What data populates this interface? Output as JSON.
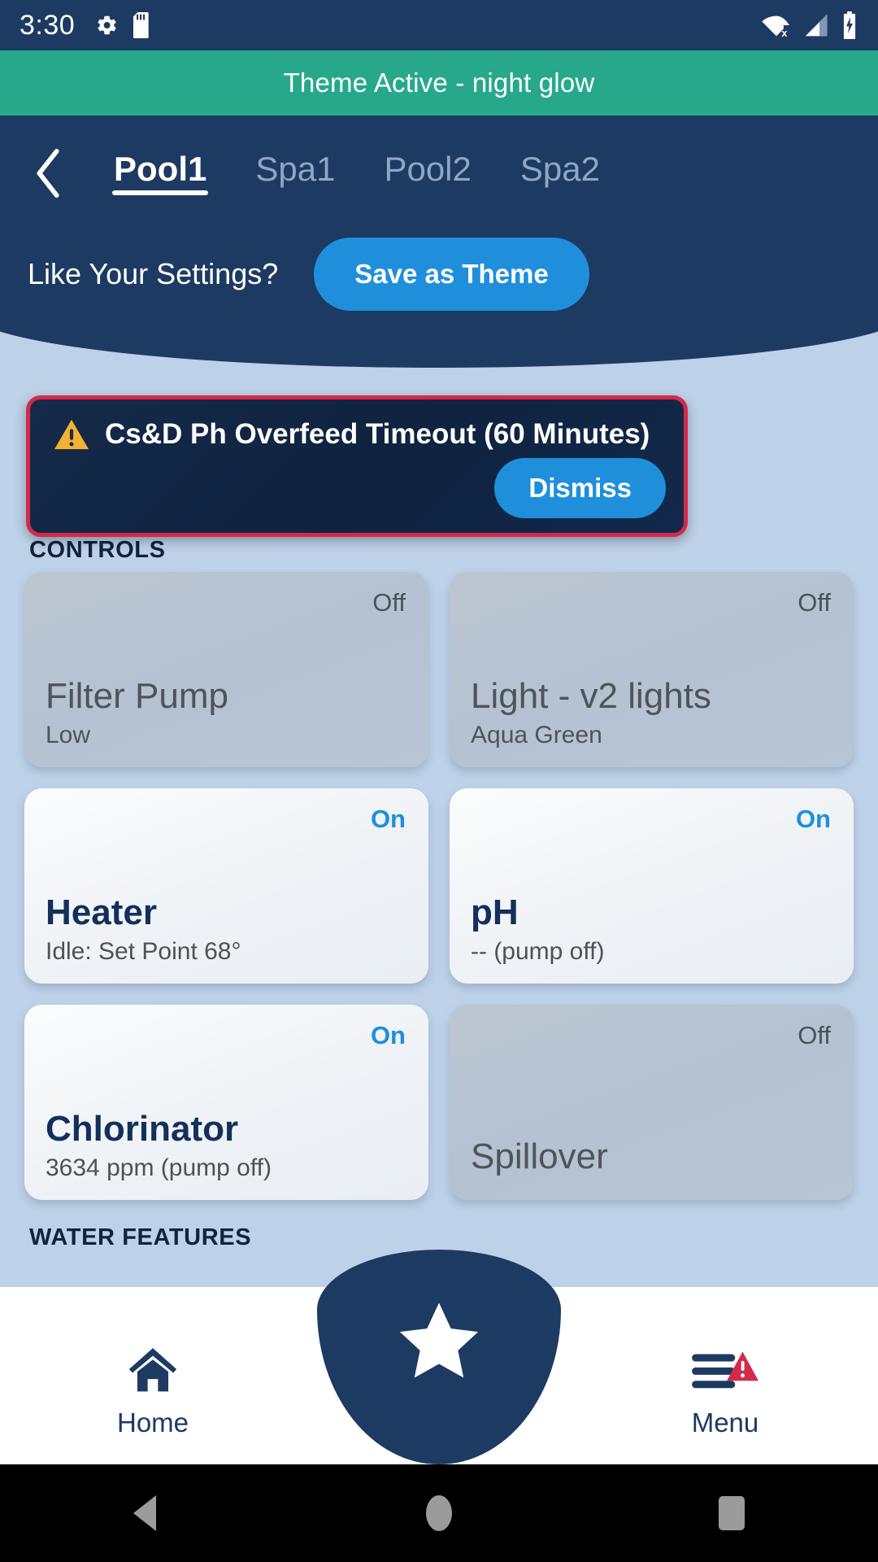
{
  "status_bar": {
    "time": "3:30",
    "left_icons": [
      "gear-icon",
      "sd-card-icon"
    ],
    "right_icons": [
      "wifi-off-icon",
      "cellular-signal-icon",
      "battery-charging-icon"
    ],
    "background": "#1d3a62"
  },
  "theme_banner": {
    "text": "Theme Active - night glow",
    "background": "#27a88b"
  },
  "header": {
    "back_icon": "chevron-left-icon",
    "tabs": [
      {
        "label": "Pool1",
        "active": true
      },
      {
        "label": "Spa1",
        "active": false
      },
      {
        "label": "Pool2",
        "active": false
      },
      {
        "label": "Spa2",
        "active": false
      }
    ],
    "settings_question": "Like Your Settings?",
    "save_theme_label": "Save as Theme",
    "accent": "#1f8fdb",
    "background": "#1d3a62"
  },
  "alert": {
    "icon": "warning-triangle-icon",
    "message": "Cs&D Ph Overfeed Timeout (60 Minutes)",
    "dismiss_label": "Dismiss",
    "border_color": "#d42a4a",
    "icon_color": "#f2b233"
  },
  "sections": {
    "controls_label": "CONTROLS",
    "water_features_label": "WATER FEATURES"
  },
  "controls": [
    {
      "name": "Filter Pump",
      "state": "Off",
      "sub": "Low",
      "on": false
    },
    {
      "name": "Light - v2 lights",
      "state": "Off",
      "sub": "Aqua Green",
      "on": false
    },
    {
      "name": "Heater",
      "state": "On",
      "sub": "Idle: Set Point 68°",
      "on": true
    },
    {
      "name": "pH",
      "state": "On",
      "sub": "-- (pump off)",
      "on": true
    },
    {
      "name": "Chlorinator",
      "state": "On",
      "sub": "3634 ppm (pump off)",
      "on": true
    },
    {
      "name": "Spillover",
      "state": "Off",
      "sub": "",
      "on": false
    }
  ],
  "bottom_nav": {
    "items": [
      {
        "label": "Home",
        "icon": "home-icon"
      },
      {
        "label": "Menu",
        "icon": "hamburger-menu-alert-icon"
      }
    ],
    "center_icon": "star-icon",
    "background": "#ffffff",
    "notch_color": "#1d3a62",
    "alert_badge_color": "#d42a4a"
  },
  "android_nav": {
    "buttons": [
      "back-triangle-icon",
      "home-circle-icon",
      "recents-square-icon"
    ]
  }
}
